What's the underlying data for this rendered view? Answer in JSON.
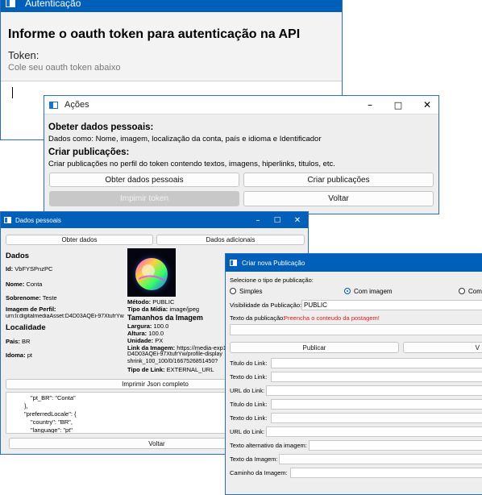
{
  "auth": {
    "title": "Autenticação",
    "heading": "Informe o oauth token para autenticação na API",
    "token_label": "Token:",
    "token_hint": "Cole seu oauth token abaixo"
  },
  "acoes": {
    "title": "Ações",
    "personal_heading": "Obeter dados pessoais:",
    "personal_desc": "Dados como: Nome, imagem, localização da conta, país e idioma e Identificador",
    "create_heading": "Criar publicações:",
    "create_desc": "Criar publicações no perfil do token contendo textos, imagens, hiperlinks, titulos, etc.",
    "btn_get": "Obter dados pessoais",
    "btn_create": "Criar publicações",
    "btn_print": "Impimir token",
    "btn_back": "Voltar"
  },
  "dados": {
    "title": "Dados pessoais",
    "btn_obter": "Obter dados",
    "btn_adicionais": "Dados adicionais",
    "section_dados": "Dados",
    "id_label": "Id:",
    "id_value": "VbFYSPnzPC",
    "nome_label": "Nome:",
    "nome_value": "Conta",
    "sobrenome_label": "Sobrenome:",
    "sobrenome_value": "Teste",
    "imagem_label": "Imagem de Perfil:",
    "imagem_value": "urn:li:digitalmediaAsset:D4D03AQEi-97XtufrYw",
    "section_localidade": "Localidade",
    "pais_label": "Pais:",
    "pais_value": "BR",
    "idioma_label": "Idoma:",
    "idioma_value": "pt",
    "metodo_label": "Método:",
    "metodo_value": "PUBLIC",
    "tipo_midia_label": "Tipo da Mídia:",
    "tipo_midia_value": "image/jpeg",
    "tamanhos_heading": "Tamanhos da Imagem",
    "largura_label": "Largura:",
    "largura_value": "100.0",
    "altura_label": "Altura:",
    "altura_value": "100.0",
    "unidade_label": "Unidade:",
    "unidade_value": "PX",
    "link_label": "Link da Imagem:",
    "link_line1": "https://media-exp1.l",
    "link_line2": "D4D03AQEi-97XtufrYw/profile-display",
    "link_line3": "shrink_100_100/0/1667526851450?",
    "tipo_link_label": "Tipo de Link:",
    "tipo_link_value": "EXTERNAL_URL",
    "btn_json": "Imprimir Json completo",
    "json_lines": [
      "\"pt_BR\": \"Conta\"",
      "},",
      "\"preferredLocale\": {",
      "\"country\": \"BR\",",
      "\"language\": \"pt\""
    ],
    "btn_voltar": "Voltar"
  },
  "pub": {
    "title": "Criar nova Publicação",
    "select_label": "Selecione o tipo de publicação:",
    "opt_simples": "Simples",
    "opt_imagem": "Com imagem",
    "opt_com": "Com",
    "visibilidade_label": "Visibilidade da Publicação:",
    "visibilidade_value": "PUBLIC",
    "texto_label": "Texto da publicação:",
    "texto_warning": "Preencha o conteudo da postagem!",
    "btn_publicar": "Publicar",
    "btn_v": "V",
    "titulo_link_1": "Titulo do Link:",
    "texto_link_1": "Texto do Link:",
    "url_link_1": "URL do Link:",
    "titulo_link_2": "Titulo do Link:",
    "texto_link_2": "Texto do Link:",
    "url_link_2": "URL do Link:",
    "texto_alt": "Texto alternativo da imagem:",
    "texto_imagem": "Texto da Imagem:",
    "caminho_imagem": "Caminho da Imagem:"
  },
  "colors": {
    "titlebar": "#005fb8",
    "warning": "#e01b1b",
    "disabled": "#c8c8c8"
  },
  "icons": [
    "app-window-icon",
    "minimize-icon",
    "maximize-icon",
    "close-icon",
    "earth-image"
  ]
}
